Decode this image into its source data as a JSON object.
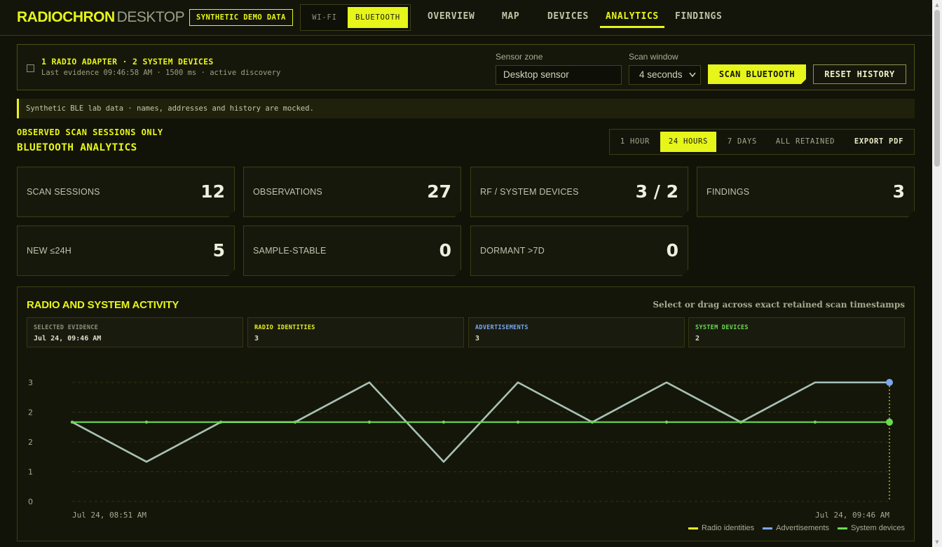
{
  "brand": {
    "name": "RADIOCHRON",
    "suffix": "DESKTOP",
    "badge": "SYNTHETIC DEMO DATA"
  },
  "mode": {
    "wifi": "WI-FI",
    "bluetooth": "BLUETOOTH",
    "selected": "BLUETOOTH"
  },
  "nav": [
    {
      "label": "OVERVIEW"
    },
    {
      "label": "MAP"
    },
    {
      "label": "DEVICES"
    },
    {
      "label": "ANALYTICS",
      "active": true
    },
    {
      "label": "FINDINGS"
    }
  ],
  "adapter": {
    "title": "1 RADIO ADAPTER · 2 SYSTEM DEVICES",
    "subtitle": "Last evidence 09:46:58 AM · 1500 ms · active discovery",
    "sensor_zone_label": "Sensor zone",
    "sensor_zone_value": "Desktop sensor",
    "scan_window_label": "Scan window",
    "scan_window_value": "4 seconds",
    "scan_button": "SCAN BLUETOOTH",
    "reset_button": "RESET HISTORY"
  },
  "notice": "Synthetic BLE lab data · names, addresses and history are mocked.",
  "section": {
    "eyebrow": "OBSERVED SCAN SESSIONS ONLY",
    "title": "BLUETOOTH ANALYTICS"
  },
  "ranges": {
    "h1": "1 HOUR",
    "h24": "24 HOURS",
    "d7": "7 DAYS",
    "all": "ALL RETAINED",
    "export": "EXPORT PDF",
    "selected": "24 HOURS"
  },
  "stats": [
    {
      "label": "SCAN SESSIONS",
      "value": "12"
    },
    {
      "label": "OBSERVATIONS",
      "value": "27"
    },
    {
      "label": "RF / SYSTEM DEVICES",
      "value": "3 / 2"
    },
    {
      "label": "FINDINGS",
      "value": "3"
    },
    {
      "label": "NEW ≤24H",
      "value": "5"
    },
    {
      "label": "SAMPLE-STABLE",
      "value": "0"
    },
    {
      "label": "DORMANT >7D",
      "value": "0"
    }
  ],
  "activity": {
    "title": "RADIO AND SYSTEM ACTIVITY",
    "hint": "Select or drag across exact retained scan timestamps",
    "selected_label": "SELECTED EVIDENCE",
    "selected_value": "Jul 24, 09:46 AM",
    "radio_label": "RADIO IDENTITIES",
    "radio_value": "3",
    "adv_label": "ADVERTISEMENTS",
    "adv_value": "3",
    "sys_label": "SYSTEM DEVICES",
    "sys_value": "2"
  },
  "colors": {
    "accent": "#e6f51a",
    "radio": "#e6f51a",
    "advertisements": "#7aa8ef",
    "system": "#6bdc50"
  },
  "chart_data": {
    "type": "line",
    "x": [
      "Jul 24, 08:51 AM",
      "",
      "",
      "",
      "",
      "",
      "",
      "",
      "",
      "",
      "",
      "Jul 24, 09:46 AM"
    ],
    "x_tick_labels": [
      "Jul 24, 08:51 AM",
      "Jul 24, 09:46 AM"
    ],
    "y_tick_labels": [
      "0",
      "1",
      "2",
      "2",
      "3"
    ],
    "ylim": [
      0,
      3
    ],
    "grid": true,
    "legend_position": "bottom-right",
    "series": [
      {
        "name": "Radio identities",
        "color": "#e6f51a",
        "values": [
          2,
          1,
          2,
          2,
          3,
          1,
          3,
          2,
          3,
          2,
          3,
          3
        ]
      },
      {
        "name": "Advertisements",
        "color": "#7aa8ef",
        "values": [
          2,
          1,
          2,
          2,
          3,
          1,
          3,
          2,
          3,
          2,
          3,
          3
        ]
      },
      {
        "name": "System devices",
        "color": "#6bdc50",
        "values": [
          2,
          2,
          2,
          2,
          2,
          2,
          2,
          2,
          2,
          2,
          2,
          2
        ]
      }
    ]
  }
}
